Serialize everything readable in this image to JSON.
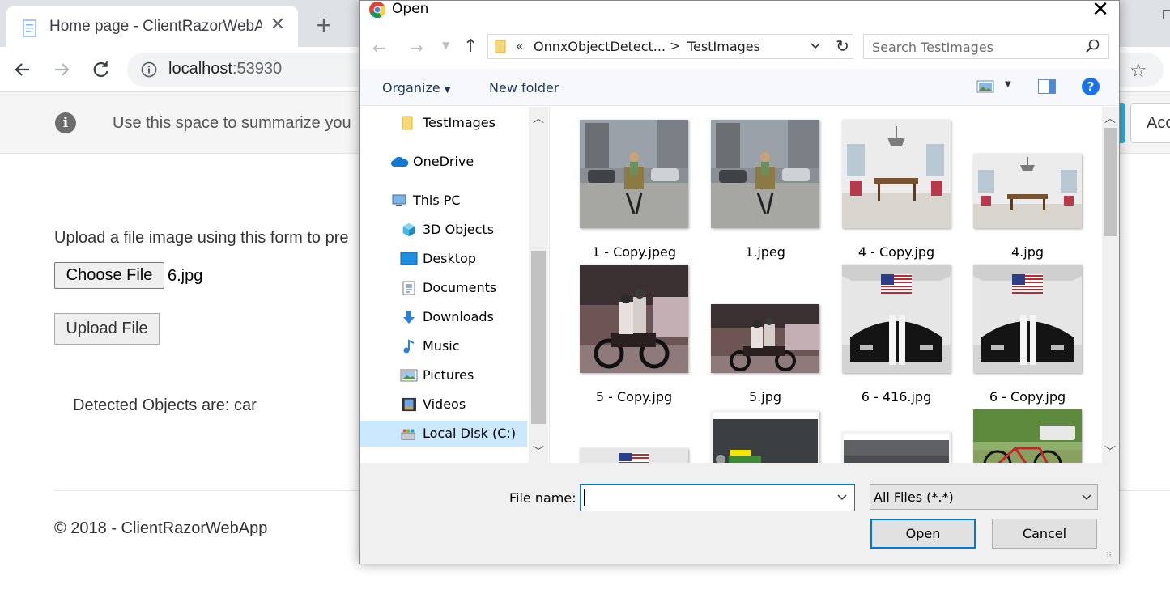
{
  "browser": {
    "tab_title": "Home page - ClientRazorWebApp",
    "url_host": "localhost",
    "url_port": ":53930",
    "icons": {
      "back": "arrow-left-icon",
      "forward": "arrow-right-icon",
      "reload": "reload-icon",
      "info": "info-icon",
      "star": "star-icon",
      "new_tab": "plus-icon",
      "close_tab": "close-icon"
    }
  },
  "page": {
    "cookie_text": "Use this space to summarize you",
    "accept_label": "Acc",
    "upload_text": "Upload a file image using this form to pre",
    "choose_file_label": "Choose File",
    "chosen_file": "6.jpg",
    "upload_button": "Upload File",
    "detected_text": "Detected Objects are: car",
    "footer": "© 2018 - ClientRazorWebApp"
  },
  "dialog": {
    "title": "Open",
    "close_glyph": "✕",
    "address": {
      "overflow": "«",
      "segment1": "OnnxObjectDetect...",
      "separator": ">",
      "segment2": "TestImages"
    },
    "search_placeholder": "Search TestImages",
    "organize_label": "Organize",
    "new_folder_label": "New folder",
    "nav": [
      {
        "label": "TestImages",
        "icon": "folder-icon",
        "selected": false
      },
      {
        "label": "OneDrive",
        "icon": "cloud-icon",
        "selected": false
      },
      {
        "label": "This PC",
        "icon": "computer-icon",
        "selected": false
      },
      {
        "label": "3D Objects",
        "icon": "cube-icon",
        "selected": false
      },
      {
        "label": "Desktop",
        "icon": "desktop-icon",
        "selected": false
      },
      {
        "label": "Documents",
        "icon": "document-icon",
        "selected": false
      },
      {
        "label": "Downloads",
        "icon": "download-icon",
        "selected": false
      },
      {
        "label": "Music",
        "icon": "music-icon",
        "selected": false
      },
      {
        "label": "Pictures",
        "icon": "pictures-icon",
        "selected": false
      },
      {
        "label": "Videos",
        "icon": "video-icon",
        "selected": false
      },
      {
        "label": "Local Disk (C:)",
        "icon": "disk-icon",
        "selected": true
      }
    ],
    "files": [
      {
        "name": "1 - Copy.jpeg",
        "scene": "street-cyclist"
      },
      {
        "name": "1.jpeg",
        "scene": "street-cyclist"
      },
      {
        "name": "4 - Copy.jpg",
        "scene": "dining-room"
      },
      {
        "name": "4.jpg",
        "scene": "dining-room"
      },
      {
        "name": "5 - Copy.jpg",
        "scene": "motorbike"
      },
      {
        "name": "5.jpg",
        "scene": "motorbike"
      },
      {
        "name": "6 - 416.jpg",
        "scene": "car-garage"
      },
      {
        "name": "6 - Copy.jpg",
        "scene": "car-garage"
      },
      {
        "name": "",
        "scene": "car-garage"
      },
      {
        "name": "",
        "scene": "app-screenshot"
      },
      {
        "name": "",
        "scene": "app-screenshot-dark"
      },
      {
        "name": "",
        "scene": "bicycle-outdoor"
      }
    ],
    "file_name_label": "File name:",
    "file_name_value": "",
    "filter_value": "All Files (*.*)",
    "open_button": "Open",
    "cancel_button": "Cancel"
  }
}
